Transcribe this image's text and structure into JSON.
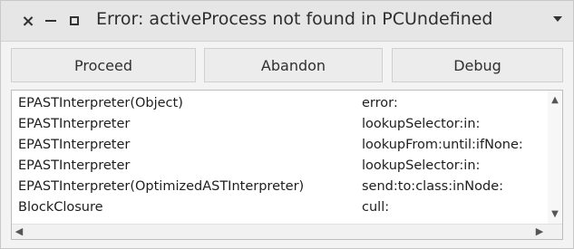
{
  "window": {
    "title": "Error: activeProcess not found in PCUndefined",
    "close_glyph": "×"
  },
  "buttons": {
    "proceed": "Proceed",
    "abandon": "Abandon",
    "debug": "Debug"
  },
  "stack": {
    "rows": [
      {
        "receiver": "EPASTInterpreter(Object)",
        "selector": "error:"
      },
      {
        "receiver": "EPASTInterpreter",
        "selector": "lookupSelector:in:"
      },
      {
        "receiver": "EPASTInterpreter",
        "selector": "lookupFrom:until:ifNone:"
      },
      {
        "receiver": "EPASTInterpreter",
        "selector": "lookupSelector:in:"
      },
      {
        "receiver": "EPASTInterpreter(OptimizedASTInterpreter)",
        "selector": "send:to:class:inNode:"
      },
      {
        "receiver": "BlockClosure",
        "selector": "cull:"
      }
    ]
  },
  "icons": {
    "close": "close-icon",
    "minimize": "minimize-icon",
    "maximize": "maximize-icon",
    "menu": "window-menu-icon",
    "scroll_up": "scroll-up-icon",
    "scroll_down": "scroll-down-icon",
    "scroll_left": "scroll-left-icon",
    "scroll_right": "scroll-right-icon"
  }
}
